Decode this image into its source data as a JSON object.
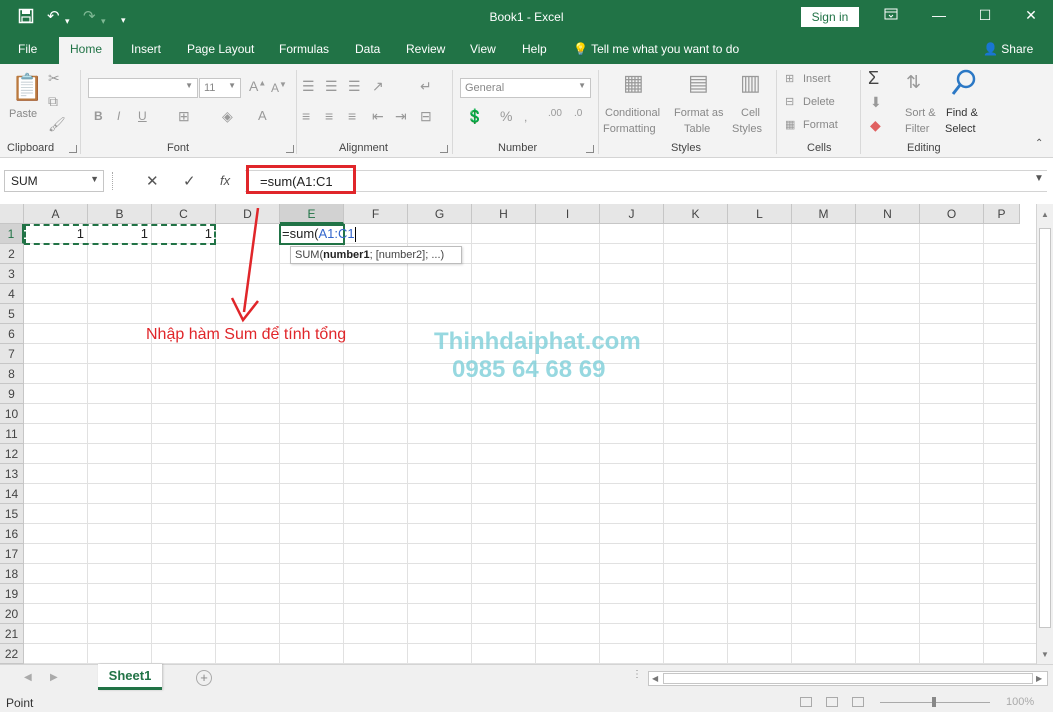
{
  "titlebar": {
    "title": "Book1  -  Excel",
    "signin": "Sign in",
    "icons": [
      "save-icon",
      "undo-icon",
      "redo-icon",
      "customize-icon",
      "ribbon-display-icon",
      "minimize-icon",
      "restore-icon",
      "close-icon"
    ]
  },
  "tabs": {
    "items": [
      {
        "label": "File"
      },
      {
        "label": "Home"
      },
      {
        "label": "Insert"
      },
      {
        "label": "Page Layout"
      },
      {
        "label": "Formulas"
      },
      {
        "label": "Data"
      },
      {
        "label": "Review"
      },
      {
        "label": "View"
      },
      {
        "label": "Help"
      }
    ],
    "active": "Home",
    "tell_me": "Tell me what you want to do",
    "share": "Share"
  },
  "ribbon": {
    "clipboard": {
      "label": "Clipboard",
      "paste": "Paste"
    },
    "font": {
      "label": "Font",
      "font_size": "11"
    },
    "alignment": {
      "label": "Alignment"
    },
    "number": {
      "label": "Number",
      "format": "General"
    },
    "styles": {
      "label": "Styles",
      "conditional_line1": "Conditional",
      "conditional_line2": "Formatting",
      "format_table_line1": "Format as",
      "format_table_line2": "Table",
      "cell_styles_line1": "Cell",
      "cell_styles_line2": "Styles"
    },
    "cells": {
      "label": "Cells",
      "insert": "Insert",
      "delete": "Delete",
      "format": "Format"
    },
    "editing": {
      "label": "Editing",
      "sort_line1": "Sort &",
      "sort_line2": "Filter",
      "find_line1": "Find &",
      "find_line2": "Select"
    }
  },
  "formula_bar": {
    "name_box": "SUM",
    "formula": "=sum(A1:C1"
  },
  "grid": {
    "columns": [
      "A",
      "B",
      "C",
      "D",
      "E",
      "F",
      "G",
      "H",
      "I",
      "J",
      "K",
      "L",
      "M",
      "N",
      "O",
      "P"
    ],
    "rows": [
      "1",
      "2",
      "3",
      "4",
      "5",
      "6",
      "7",
      "8",
      "9",
      "10",
      "11",
      "12",
      "13",
      "14",
      "15",
      "16",
      "17",
      "18",
      "19",
      "20",
      "21",
      "22"
    ],
    "selected_column": "E",
    "selected_row": "1",
    "cells": {
      "A1": "1",
      "B1": "1",
      "C1": "1"
    },
    "active_cell_prefix": "=sum(",
    "active_cell_ref": "A1:C1",
    "tooltip_fn": "SUM(",
    "tooltip_arg1": "number1",
    "tooltip_rest": "; [number2]; ...)"
  },
  "annotation": {
    "text": "Nhập hàm Sum để tính tổng",
    "color": "#e0262a"
  },
  "watermark": {
    "line1": "Thinhdaiphat.com",
    "line2": "0985 64 68 69"
  },
  "sheets": {
    "tabs": [
      "Sheet1"
    ],
    "active": "Sheet1"
  },
  "status": {
    "mode": "Point",
    "zoom": "100%"
  },
  "colors": {
    "accent": "#217346",
    "highlight": "#e0262a",
    "reference": "#3366cc"
  }
}
